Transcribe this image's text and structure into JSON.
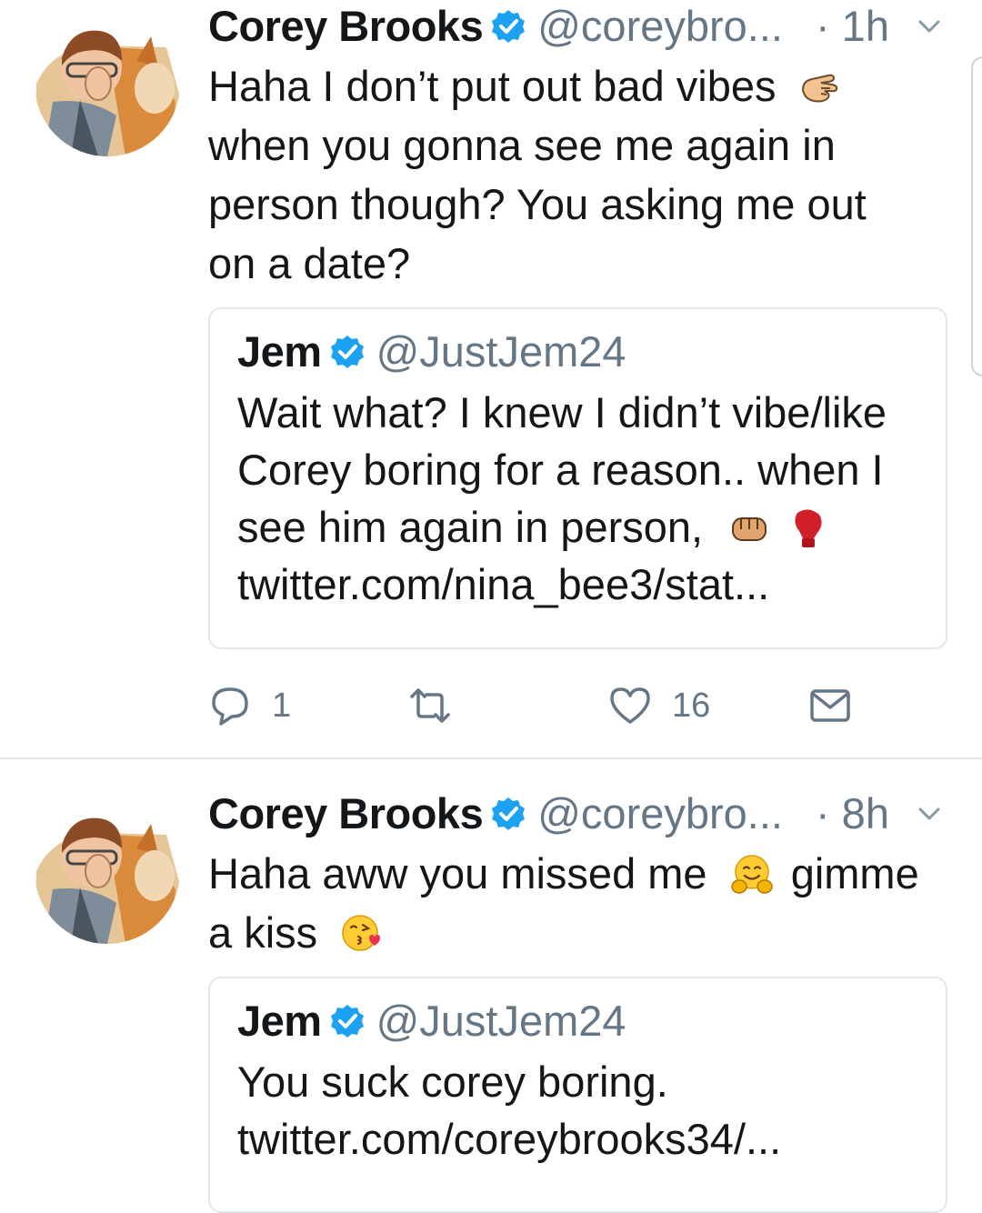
{
  "tweets": [
    {
      "name": "Corey Brooks",
      "handle": "@coreybro...",
      "time": "· 1h",
      "text_line1": "Haha I don’t put out bad vibes",
      "text_line2": "when you gonna see me again in",
      "text_line3": "person though?  You asking me out",
      "text_line4": "on a date?",
      "emoji_1": "hand-pointing-icon",
      "quote": {
        "name": "Jem",
        "handle": "@JustJem24",
        "line1": "Wait what? I knew I didn’t vibe/like",
        "line2": "Corey boring for a reason.. when I",
        "line3": "see him again in person,",
        "line4": "twitter.com/nina_bee3/stat...",
        "emoji_fist": "fist-icon",
        "emoji_glove": "boxing-glove-icon"
      },
      "actions": {
        "reply_count": "1",
        "like_count": "16"
      }
    },
    {
      "name": "Corey Brooks",
      "handle": "@coreybro...",
      "time": "· 8h",
      "text_line1a": "Haha aww you missed me",
      "text_line1b": "gimme",
      "text_line2": "a kiss",
      "emoji_hug": "hugging-face-icon",
      "emoji_kiss": "face-blowing-kiss-icon",
      "quote": {
        "name": "Jem",
        "handle": "@JustJem24",
        "line1": "You suck corey boring.",
        "line2": "twitter.com/coreybrooks34/..."
      }
    }
  ],
  "colors": {
    "text": "#14171a",
    "secondary": "#657786",
    "verified": "#1da1f2",
    "border": "#e1e8ed"
  }
}
